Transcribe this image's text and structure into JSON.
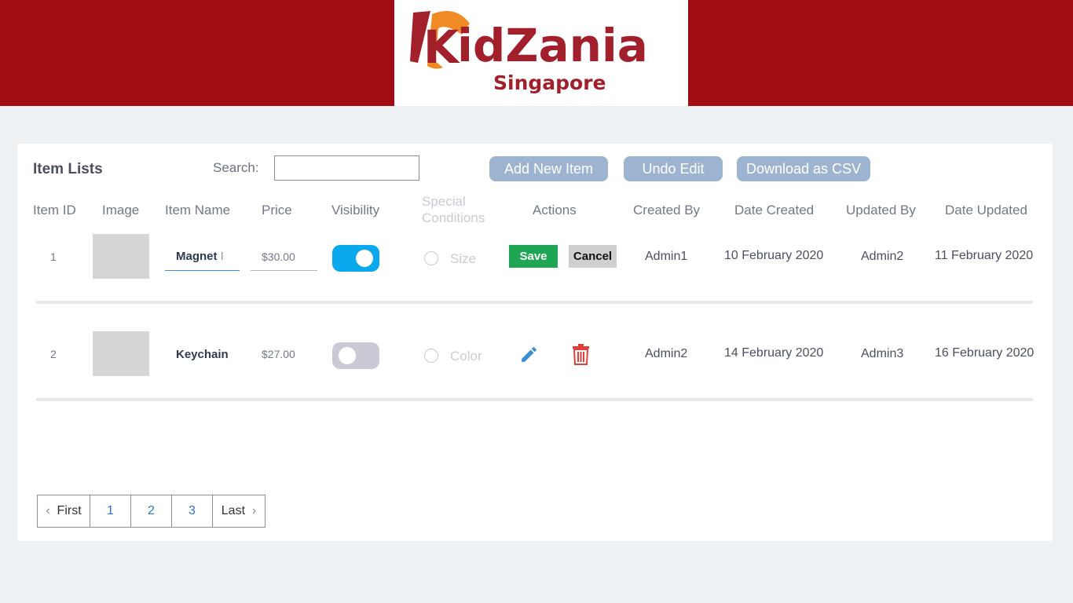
{
  "brand": {
    "name_part1": "K",
    "name_part2": "idZania",
    "subtitle": "Singapore",
    "colors": {
      "header": "#a00c12",
      "brand_red": "#a2202b",
      "brand_orange": "#f08a24"
    }
  },
  "toolbar": {
    "title": "Item Lists",
    "search_label": "Search:",
    "search_value": "",
    "add_label": "Add New Item",
    "undo_label": "Undo Edit",
    "download_label": "Download as CSV"
  },
  "table": {
    "headers": {
      "id": "Item ID",
      "image": "Image",
      "name": "Item Name",
      "price": "Price",
      "visibility": "Visibility",
      "special": "Special Conditions",
      "actions": "Actions",
      "created_by": "Created By",
      "date_created": "Date Created",
      "updated_by": "Updated By",
      "date_updated": "Date Updated"
    },
    "rows": [
      {
        "id": "1",
        "name": "Magnet",
        "price": "$30.00",
        "visible": true,
        "condition": "Size",
        "save_label": "Save",
        "cancel_label": "Cancel",
        "created_by": "Admin1",
        "date_created": "10 February 2020",
        "updated_by": "Admin2",
        "date_updated": "11 February 2020"
      },
      {
        "id": "2",
        "name": "Keychain",
        "price": "$27.00",
        "visible": false,
        "condition": "Color",
        "created_by": "Admin2",
        "date_created": "14 February 2020",
        "updated_by": "Admin3",
        "date_updated": "16 February 2020"
      }
    ]
  },
  "pagination": {
    "first": "First",
    "pages": [
      "1",
      "2",
      "3"
    ],
    "last": "Last"
  },
  "icons": {
    "edit": "pencil-icon",
    "delete": "trash-icon",
    "prev": "chevron-left-icon",
    "next": "chevron-right-icon"
  }
}
